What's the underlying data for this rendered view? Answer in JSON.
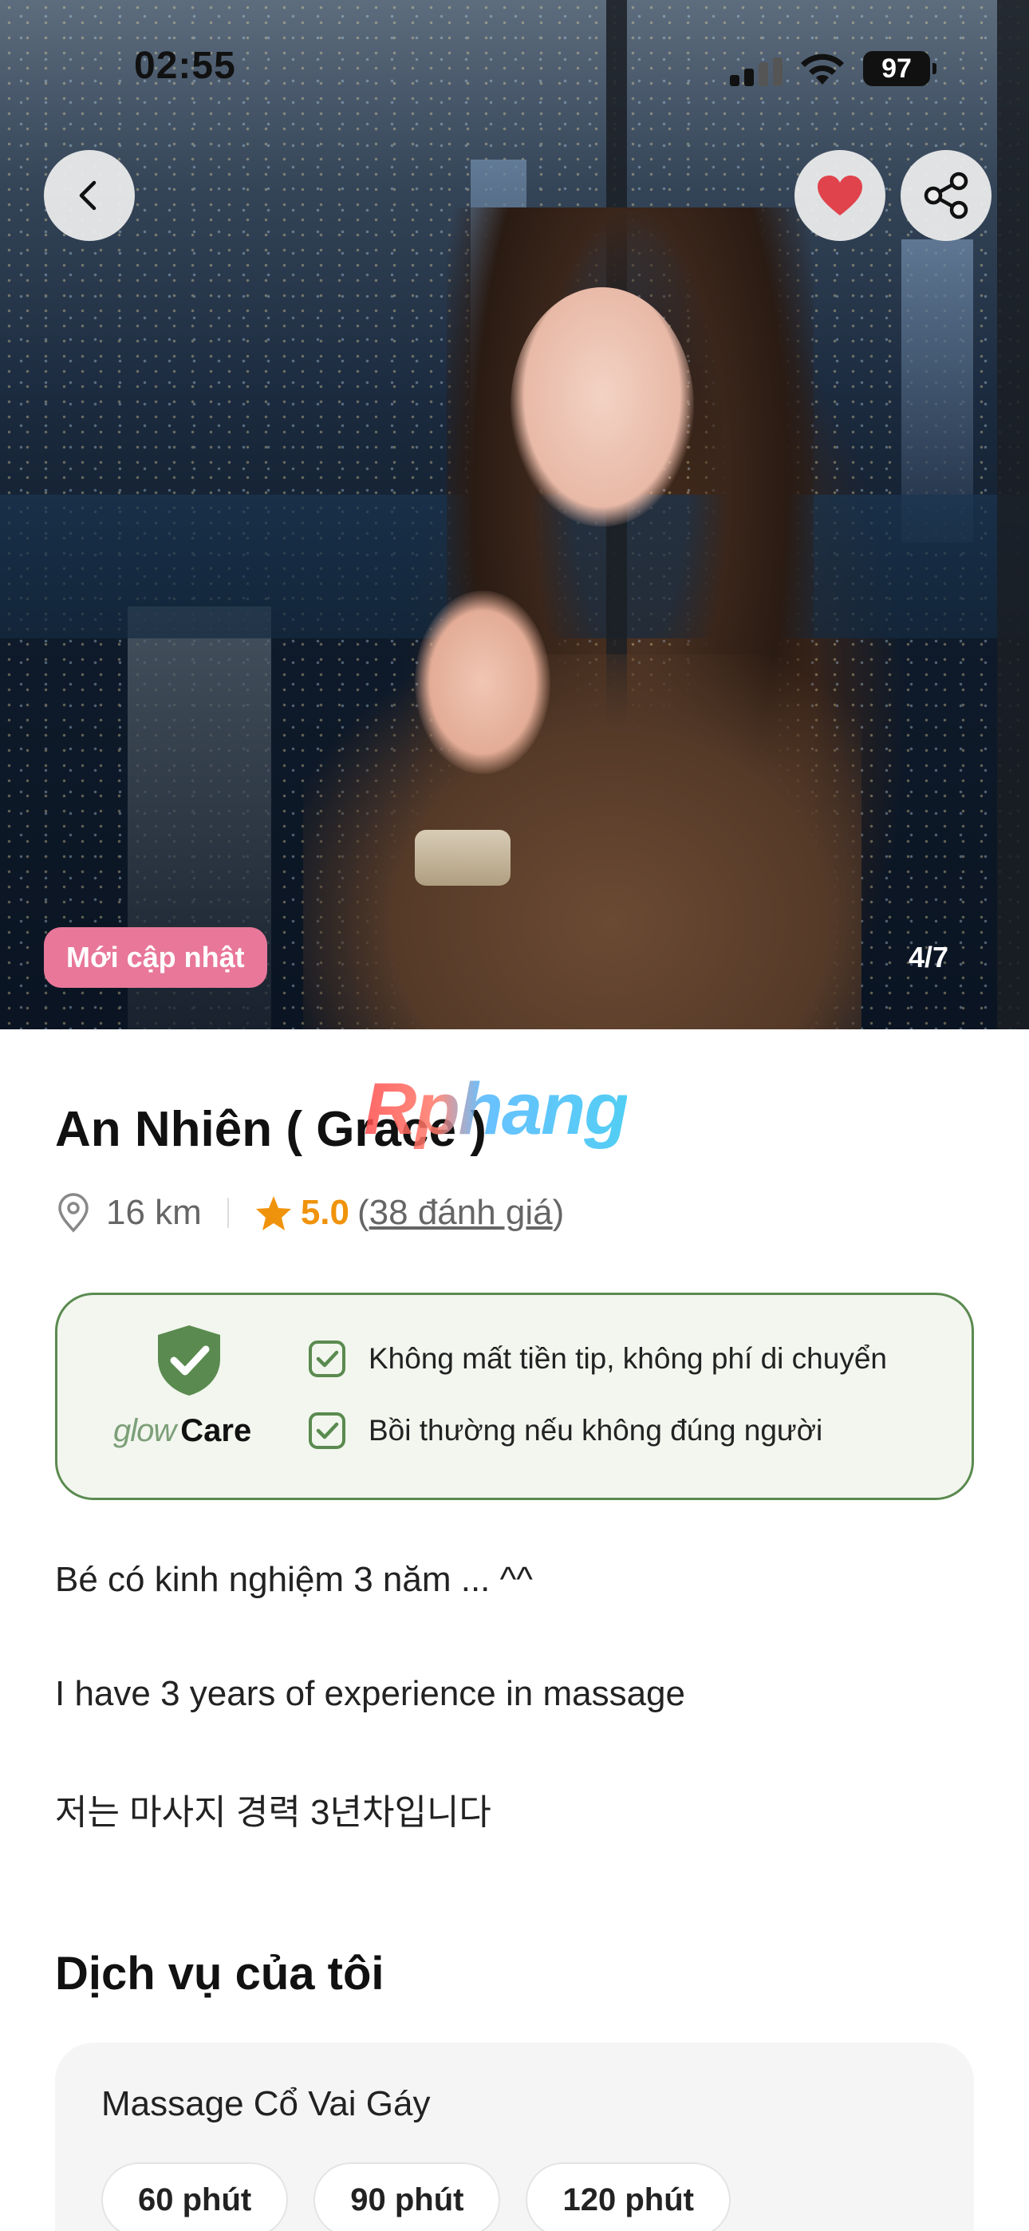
{
  "status_bar": {
    "time": "02:55",
    "battery": "97"
  },
  "hero": {
    "badge_label": "Mới cập nhật",
    "photo_counter": "4/7",
    "icons": {
      "back": "chevron-left-icon",
      "favorite": "heart-icon",
      "share": "share-icon"
    },
    "favorite_color": "#e0434c"
  },
  "profile": {
    "name": "An Nhiên ( Grace )",
    "watermark": "Rphang",
    "distance": "16 km",
    "rating": "5.0",
    "reviews_open": "(",
    "reviews": "38 đánh giá",
    "reviews_close": ")"
  },
  "glow_care": {
    "logo_glow": "glow",
    "logo_care": "Care",
    "items": [
      "Không mất tiền tip, không phí di chuyển",
      "Bồi thường nếu không đúng người"
    ],
    "accent_color": "#5a8a4f"
  },
  "bio": [
    "Bé có kinh nghiệm 3 năm ... ^^",
    "I have 3 years of experience in massage",
    "저는 마사지 경력 3년차입니다"
  ],
  "services": {
    "title": "Dịch vụ của tôi",
    "items": [
      {
        "name": "Massage Cổ Vai Gáy",
        "durations": [
          "60 phút",
          "90 phút",
          "120 phút"
        ]
      }
    ]
  }
}
